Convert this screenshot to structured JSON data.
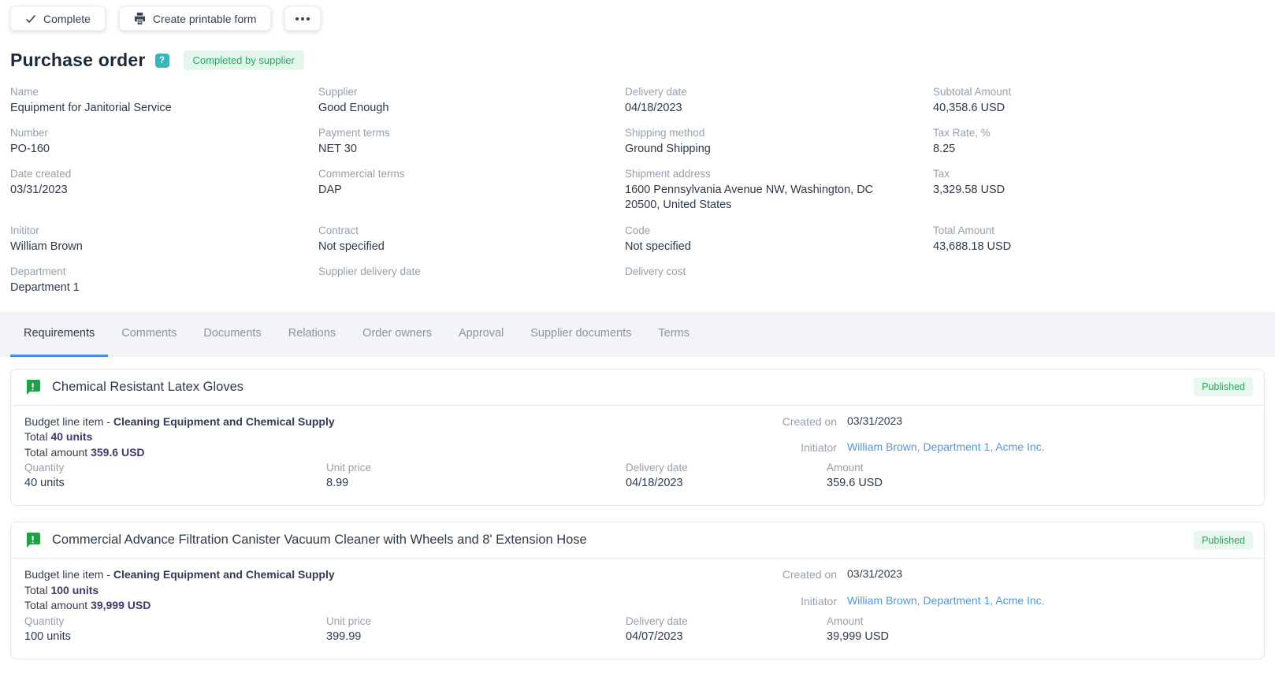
{
  "toolbar": {
    "complete_label": "Complete",
    "printable_label": "Create printable form",
    "more_label": "•••"
  },
  "header": {
    "title": "Purchase order",
    "help_glyph": "?",
    "status_badge": "Completed by supplier"
  },
  "fields": [
    {
      "label": "Name",
      "value": "Equipment for Janitorial Service"
    },
    {
      "label": "Supplier",
      "value": "Good Enough"
    },
    {
      "label": "Delivery date",
      "value": "04/18/2023"
    },
    {
      "label": "Subtotal Amount",
      "value": "40,358.6 USD"
    },
    {
      "label": "Number",
      "value": "PO-160"
    },
    {
      "label": "Payment terms",
      "value": "NET 30"
    },
    {
      "label": "Shipping method",
      "value": "Ground Shipping"
    },
    {
      "label": "Tax Rate, %",
      "value": "8.25"
    },
    {
      "label": "Date created",
      "value": "03/31/2023"
    },
    {
      "label": "Commercial terms",
      "value": "DAP"
    },
    {
      "label": "Shipment address",
      "value": "1600 Pennsylvania Avenue NW, Washington, DC 20500, United States"
    },
    {
      "label": "Tax",
      "value": "3,329.58 USD"
    },
    {
      "label": "Inititor",
      "value": "William Brown"
    },
    {
      "label": "Contract",
      "value": "Not specified"
    },
    {
      "label": "Code",
      "value": "Not specified"
    },
    {
      "label": "Total Amount",
      "value": "43,688.18 USD"
    },
    {
      "label": "Department",
      "value": "Department 1"
    },
    {
      "label": "Supplier delivery date",
      "value": ""
    },
    {
      "label": "Delivery cost",
      "value": ""
    },
    {
      "label": "",
      "value": ""
    }
  ],
  "tabs": [
    {
      "label": "Requirements"
    },
    {
      "label": "Comments"
    },
    {
      "label": "Documents"
    },
    {
      "label": "Relations"
    },
    {
      "label": "Order owners"
    },
    {
      "label": "Approval"
    },
    {
      "label": "Supplier documents"
    },
    {
      "label": "Terms"
    }
  ],
  "cards": [
    {
      "title": "Chemical Resistant Latex Gloves",
      "status": "Published",
      "budget_prefix": "Budget line item - ",
      "budget_item": "Cleaning Equipment and Chemical Supply",
      "total_prefix": "Total ",
      "total_units": "40 units",
      "total_amount_prefix": "Total amount ",
      "total_amount": "359.6 USD",
      "created_on_label": "Created on",
      "created_on": "03/31/2023",
      "initiator_label": "Initiator",
      "initiator": "William Brown, Department 1, Acme Inc.",
      "quantity_label": "Quantity",
      "quantity": "40 units",
      "unit_price_label": "Unit price",
      "unit_price": "8.99",
      "delivery_date_label": "Delivery date",
      "delivery_date": "04/18/2023",
      "amount_label": "Amount",
      "amount": "359.6 USD"
    },
    {
      "title": "Commercial Advance Filtration Canister Vacuum Cleaner with Wheels and 8' Extension Hose",
      "status": "Published",
      "budget_prefix": "Budget line item - ",
      "budget_item": "Cleaning Equipment and Chemical Supply",
      "total_prefix": "Total ",
      "total_units": "100 units",
      "total_amount_prefix": "Total amount ",
      "total_amount": "39,999 USD",
      "created_on_label": "Created on",
      "created_on": "03/31/2023",
      "initiator_label": "Initiator",
      "initiator": "William Brown, Department 1, Acme Inc.",
      "quantity_label": "Quantity",
      "quantity": "100 units",
      "unit_price_label": "Unit price",
      "unit_price": "399.99",
      "delivery_date_label": "Delivery date",
      "delivery_date": "04/07/2023",
      "amount_label": "Amount",
      "amount": "39,999 USD"
    }
  ],
  "colors": {
    "accent_blue": "#4a90e2",
    "link_blue": "#5596d6",
    "icon_green": "#23a047",
    "badge_green_bg": "#e9f8ef",
    "badge_green_text": "#27a35c",
    "help_teal": "#38b6ba"
  }
}
